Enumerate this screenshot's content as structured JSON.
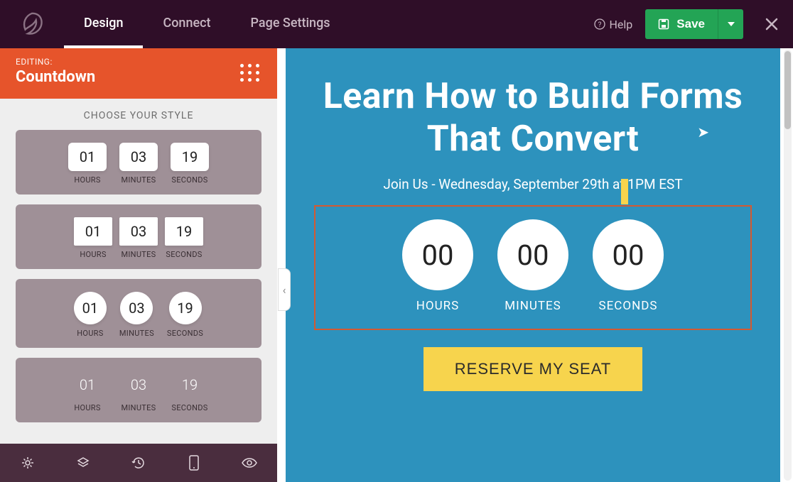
{
  "topbar": {
    "nav": {
      "design": "Design",
      "connect": "Connect",
      "pagesettings": "Page Settings"
    },
    "help": "Help",
    "save": "Save"
  },
  "sidebar": {
    "editing_label": "EDITING:",
    "editing_title": "Countdown",
    "style_heading": "CHOOSE YOUR STYLE",
    "styles": [
      {
        "hours": "01",
        "minutes": "03",
        "seconds": "19",
        "hl": "HOURS",
        "ml": "MINUTES",
        "sl": "SECONDS"
      },
      {
        "hours": "01",
        "minutes": "03",
        "seconds": "19",
        "hl": "HOURS",
        "ml": "MINUTES",
        "sl": "SECONDS"
      },
      {
        "hours": "01",
        "minutes": "03",
        "seconds": "19",
        "hl": "HOURS",
        "ml": "MINUTES",
        "sl": "SECONDS"
      },
      {
        "hours": "01",
        "minutes": "03",
        "seconds": "19",
        "hl": "HOURS",
        "ml": "MINUTES",
        "sl": "SECONDS"
      }
    ]
  },
  "canvas": {
    "headline": "Learn How to Build Forms That Convert",
    "subhead": "Join Us - Wednesday, September 29th at 1PM EST",
    "countdown": {
      "h": "00",
      "m": "00",
      "s": "00",
      "hl": "HOURS",
      "ml": "MINUTES",
      "sl": "SECONDS"
    },
    "cta": "RESERVE MY SEAT"
  },
  "colors": {
    "accent": "#e6542b",
    "brand": "#23a455",
    "canvas": "#2d92bd",
    "cta": "#f7d44d"
  }
}
